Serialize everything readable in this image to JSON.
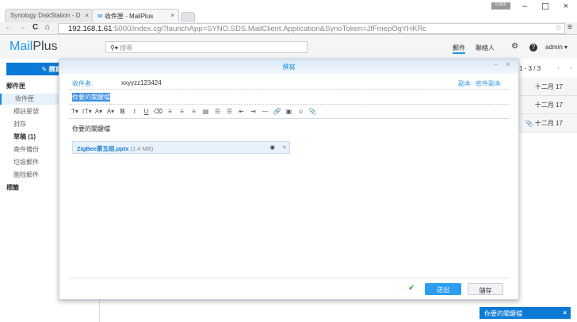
{
  "browser": {
    "tabs": [
      {
        "label": "Synology DiskStation - D"
      },
      {
        "label": "收件匣 - MailPlus"
      }
    ],
    "user_badge": "Eden",
    "url_host": "192.168.1.61",
    "url_rest": ":5000/index.cgi?launchApp=SYNO.SDS.MailClient.Application&SynoToken=JfFmepOgYHKRc",
    "icons": {
      "back": "←",
      "forward": "→",
      "reload": "C",
      "home": "⌂",
      "star": "☆",
      "menu": "≡",
      "close": "×",
      "minimize": "–",
      "maximize": "☐"
    }
  },
  "app": {
    "logo_a": "Mail",
    "logo_b": "Plus",
    "search_placeholder": "搜尋",
    "nav_mail": "郵件",
    "nav_contacts": "聯絡人",
    "user": "admin"
  },
  "sidebar": {
    "compose": "撰寫",
    "mailbox_header": "郵件匣",
    "items": [
      "收件匣",
      "標註星號",
      "封存",
      "草稿 (1)",
      "寄件備份",
      "垃圾郵件",
      "刪除郵件"
    ],
    "labels_header": "標籤"
  },
  "list": {
    "paging": "1 - 3 / 3",
    "rows": [
      "十二月 17",
      "十二月 17",
      "十二月 17"
    ]
  },
  "compose": {
    "title": "撰寫",
    "to_label": "收件者:",
    "to_value": "xxyyzz123424",
    "cc": "副本",
    "bcc": "密件副本",
    "subject": "你要的關鍵檔",
    "body": "你要的關鍵檔",
    "attachment_name": "ZigBee第五组.pptx",
    "attachment_size": "(1.4 MB)",
    "send": "送出",
    "draft": "儲存"
  },
  "toast": {
    "text": "你要的關鍵檔"
  }
}
